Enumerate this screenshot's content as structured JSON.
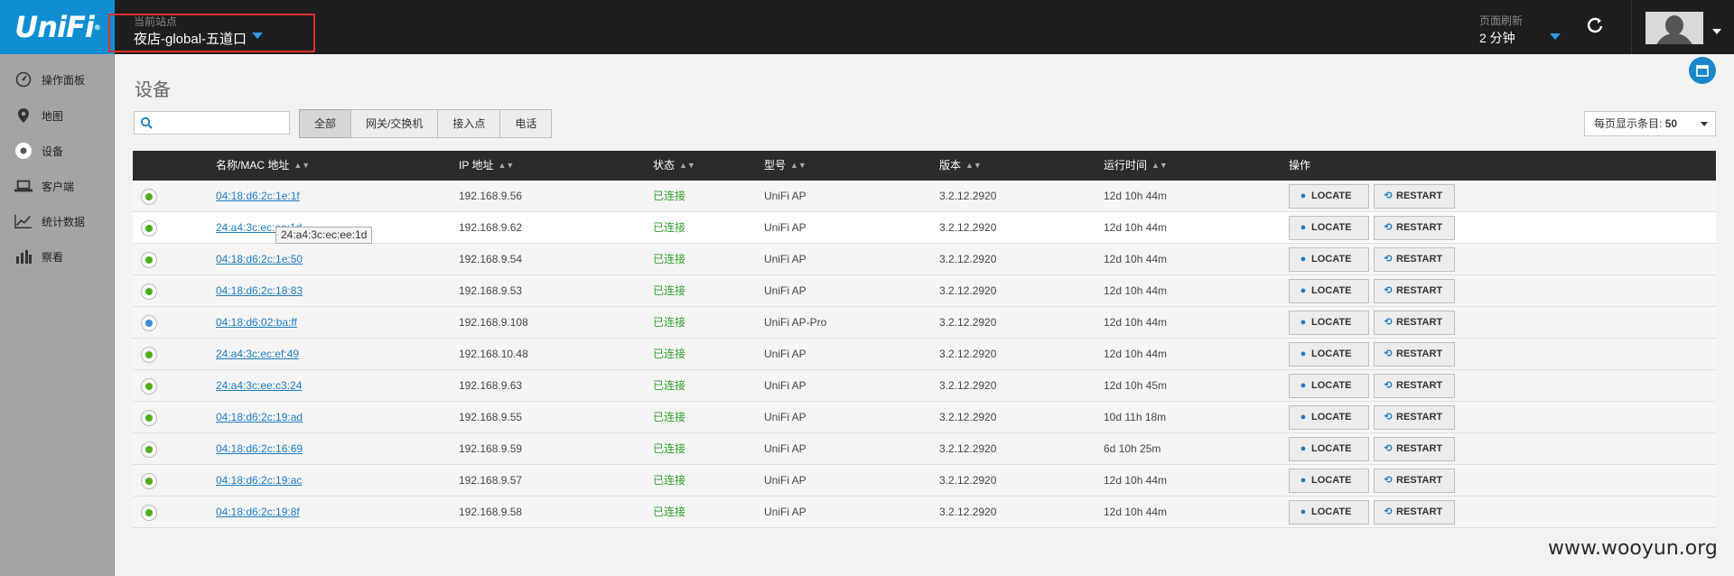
{
  "brand": {
    "name": "UniFi",
    "mark": "®"
  },
  "site": {
    "label": "当前站点",
    "name": "夜店-global-五道口"
  },
  "refresh": {
    "label": "页面刷新",
    "value": "2 分钟"
  },
  "sidebar": {
    "items": [
      {
        "label": "操作面板",
        "icon": "dashboard-icon"
      },
      {
        "label": "地图",
        "icon": "map-pin-icon"
      },
      {
        "label": "设备",
        "icon": "devices-icon",
        "active": true
      },
      {
        "label": "客户端",
        "icon": "laptop-icon"
      },
      {
        "label": "统计数据",
        "icon": "line-chart-icon"
      },
      {
        "label": "察看",
        "icon": "bar-chart-icon"
      }
    ]
  },
  "page": {
    "title": "设备"
  },
  "search": {
    "value": "",
    "placeholder": ""
  },
  "filters": [
    "全部",
    "网关/交换机",
    "接入点",
    "电话"
  ],
  "active_filter": "全部",
  "perpage": {
    "label": "每页显示条目:",
    "value": "50"
  },
  "table": {
    "headers": {
      "name": "名称/MAC 地址",
      "ip": "IP 地址",
      "status": "状态",
      "model": "型号",
      "version": "版本",
      "uptime": "运行时间",
      "actions": "操作"
    },
    "locate_label": "LOCATE",
    "restart_label": "RESTART",
    "rows": [
      {
        "mac": "04:18:d6:2c:1e:1f",
        "ip": "192.168.9.56",
        "status": "已连接",
        "model": "UniFi AP",
        "version": "3.2.12.2920",
        "uptime": "12d 10h 44m",
        "dot": "green"
      },
      {
        "mac": "24:a4:3c:ec:ee:1d",
        "ip": "192.168.9.62",
        "status": "已连接",
        "model": "UniFi AP",
        "version": "3.2.12.2920",
        "uptime": "12d 10h 44m",
        "dot": "green"
      },
      {
        "mac": "04:18:d6:2c:1e:50",
        "ip": "192.168.9.54",
        "status": "已连接",
        "model": "UniFi AP",
        "version": "3.2.12.2920",
        "uptime": "12d 10h 44m",
        "dot": "green"
      },
      {
        "mac": "04:18:d6:2c:18:83",
        "ip": "192.168.9.53",
        "status": "已连接",
        "model": "UniFi AP",
        "version": "3.2.12.2920",
        "uptime": "12d 10h 44m",
        "dot": "green"
      },
      {
        "mac": "04:18:d6:02:ba:ff",
        "ip": "192.168.9.108",
        "status": "已连接",
        "model": "UniFi AP-Pro",
        "version": "3.2.12.2920",
        "uptime": "12d 10h 44m",
        "dot": "blue"
      },
      {
        "mac": "24:a4:3c:ec:ef:49",
        "ip": "192.168.10.48",
        "status": "已连接",
        "model": "UniFi AP",
        "version": "3.2.12.2920",
        "uptime": "12d 10h 44m",
        "dot": "green"
      },
      {
        "mac": "24:a4:3c:ee:c3:24",
        "ip": "192.168.9.63",
        "status": "已连接",
        "model": "UniFi AP",
        "version": "3.2.12.2920",
        "uptime": "12d 10h 45m",
        "dot": "green"
      },
      {
        "mac": "04:18:d6:2c:19:ad",
        "ip": "192.168.9.55",
        "status": "已连接",
        "model": "UniFi AP",
        "version": "3.2.12.2920",
        "uptime": "10d 11h 18m",
        "dot": "green"
      },
      {
        "mac": "04:18:d6:2c:16:69",
        "ip": "192.168.9.59",
        "status": "已连接",
        "model": "UniFi AP",
        "version": "3.2.12.2920",
        "uptime": "6d 10h 25m",
        "dot": "green"
      },
      {
        "mac": "04:18:d6:2c:19:ac",
        "ip": "192.168.9.57",
        "status": "已连接",
        "model": "UniFi AP",
        "version": "3.2.12.2920",
        "uptime": "12d 10h 44m",
        "dot": "green"
      },
      {
        "mac": "04:18:d6:2c:19:8f",
        "ip": "192.168.9.58",
        "status": "已连接",
        "model": "UniFi AP",
        "version": "3.2.12.2920",
        "uptime": "12d 10h 44m",
        "dot": "green"
      }
    ]
  },
  "tooltip": {
    "text": "24:a4:3c:ec:ee:1d",
    "truncated_link": "24:a4:3c:ec:ee:1d"
  },
  "watermark": "www.wooyun.org",
  "colors": {
    "brand": "#0f8fd2",
    "topbar": "#1e1e1e",
    "sidebar": "#a4a4a4",
    "link": "#1a7bc3",
    "connected": "#2e9f2a",
    "highlight_box": "#e0302e"
  }
}
